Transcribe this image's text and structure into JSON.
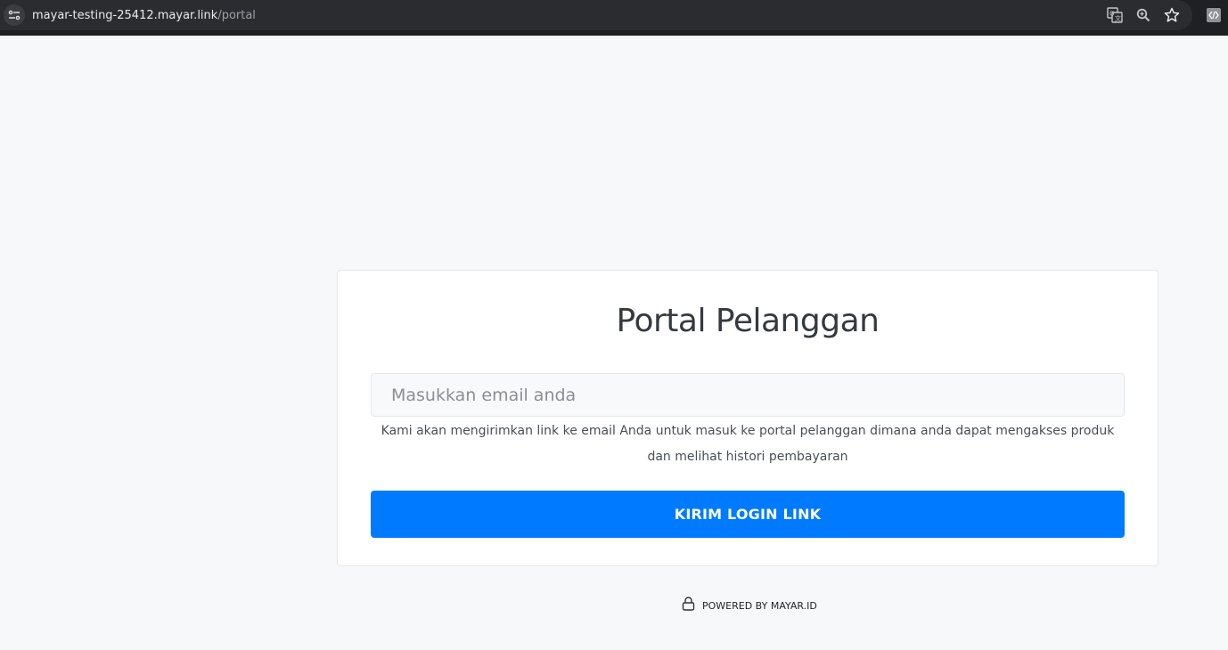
{
  "browser": {
    "url_host": "mayar-testing-25412.mayar.link",
    "url_path": "/portal",
    "icons": [
      "site-info-icon",
      "translate-icon",
      "zoom-icon",
      "bookmark-star-icon",
      "extension-icon"
    ]
  },
  "portal": {
    "title": "Portal Pelanggan",
    "email_placeholder": "Masukkan email anda",
    "helper_text": "Kami akan mengirimkan link ke email Anda untuk masuk ke portal pelanggan dimana anda dapat mengakses produk dan melihat histori pembayaran",
    "submit_label": "KIRIM LOGIN LINK",
    "accent_color": "#007bff"
  },
  "footer": {
    "powered_by": "POWERED BY MAYAR.ID",
    "icon": "lock-icon"
  }
}
